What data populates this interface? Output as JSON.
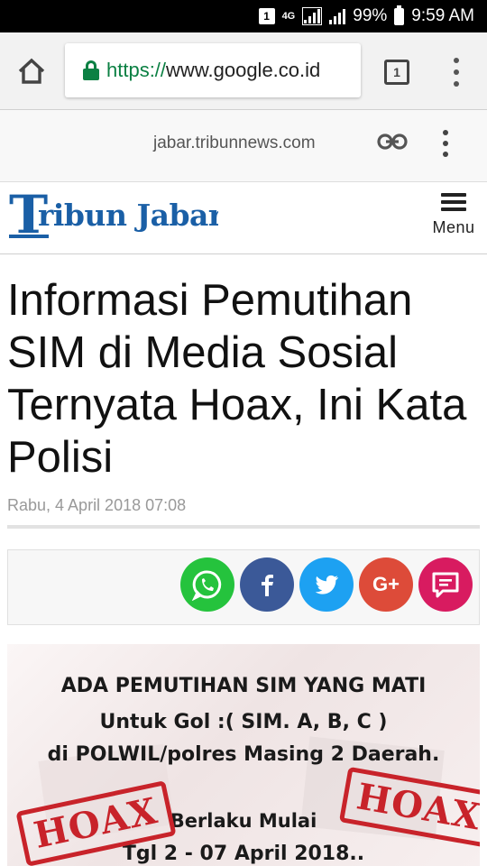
{
  "status_bar": {
    "notification_badge": "1",
    "network": "4G",
    "battery": "99%",
    "time": "9:59 AM"
  },
  "browser": {
    "url_scheme": "https://",
    "url_host": "www.google.co.id",
    "tab_count": "1"
  },
  "custom_tab": {
    "domain": "jabar.tribunnews.com"
  },
  "site": {
    "logo_text": "Tribun Jabar",
    "menu_label": "Menu"
  },
  "article": {
    "title": "Informasi Pemutihan SIM di Media Sosial Ternyata Hoax, Ini Kata Polisi",
    "date": "Rabu, 4 April 2018 07:08"
  },
  "share_buttons": [
    {
      "name": "whatsapp",
      "color": "#25c33d"
    },
    {
      "name": "facebook",
      "color": "#3b5998"
    },
    {
      "name": "twitter",
      "color": "#1da1f2"
    },
    {
      "name": "google-plus",
      "color": "#dd4b39"
    },
    {
      "name": "comment",
      "color": "#d81b60"
    }
  ],
  "image": {
    "line1": "ADA PEMUTIHAN SIM YANG MATI",
    "line2": "Untuk Gol :( SIM. A, B, C )",
    "line3": "di POLWIL/polres  Masing 2 Daerah.",
    "line4": "Berlaku Mulai",
    "line5": "Tgl 2 - 07 April  2018..",
    "stamp": "HOAX"
  },
  "colors": {
    "tribun_blue": "#1a5fa6",
    "secure_green": "#0b8043",
    "hoax_red": "#c8232a"
  }
}
